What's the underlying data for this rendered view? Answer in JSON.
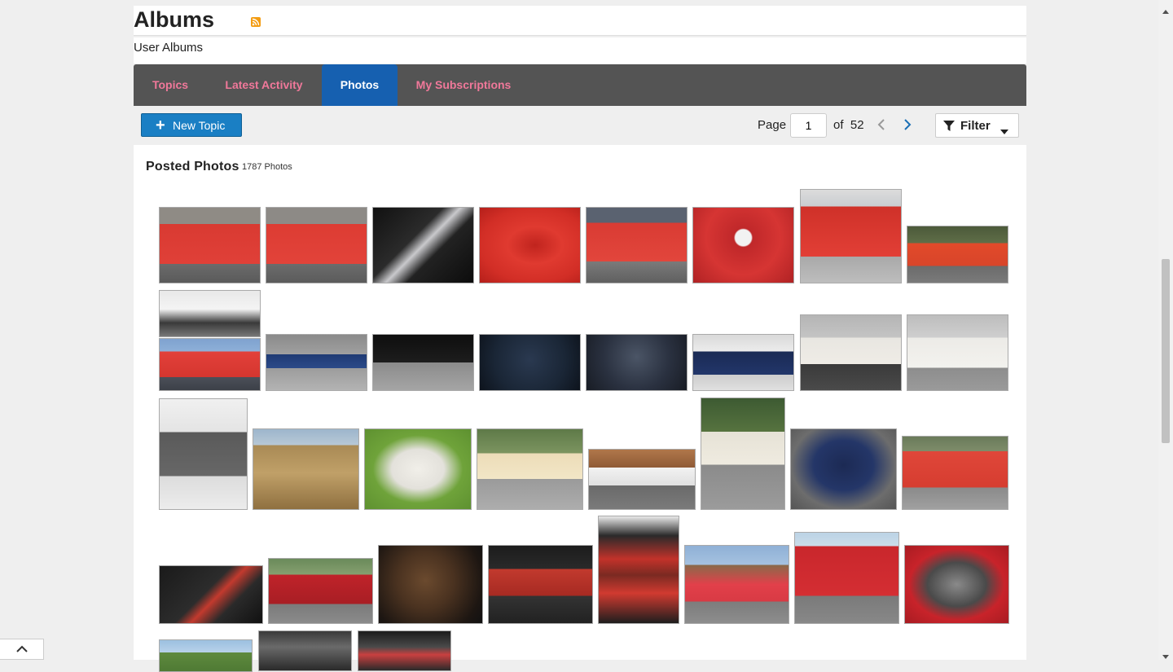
{
  "header": {
    "title": "Albums",
    "subtitle": "User Albums",
    "rss_icon": "rss-icon"
  },
  "tabs": [
    {
      "label": "Topics",
      "active": false
    },
    {
      "label": "Latest Activity",
      "active": false
    },
    {
      "label": "Photos",
      "active": true
    },
    {
      "label": "My Subscriptions",
      "active": false
    }
  ],
  "toolbar": {
    "new_topic_label": "New Topic",
    "page_label": "Page",
    "page_value": "1",
    "of_label": "of",
    "total_pages": "52",
    "filter_label": "Filter"
  },
  "photos": {
    "heading": "Posted Photos",
    "count_label": "1787 Photos"
  },
  "colors": {
    "accent": "#1660b0",
    "button": "#1a7fc4",
    "tab_text": "#f0789a",
    "tabbar": "#545454",
    "rss": "#f39c12"
  }
}
